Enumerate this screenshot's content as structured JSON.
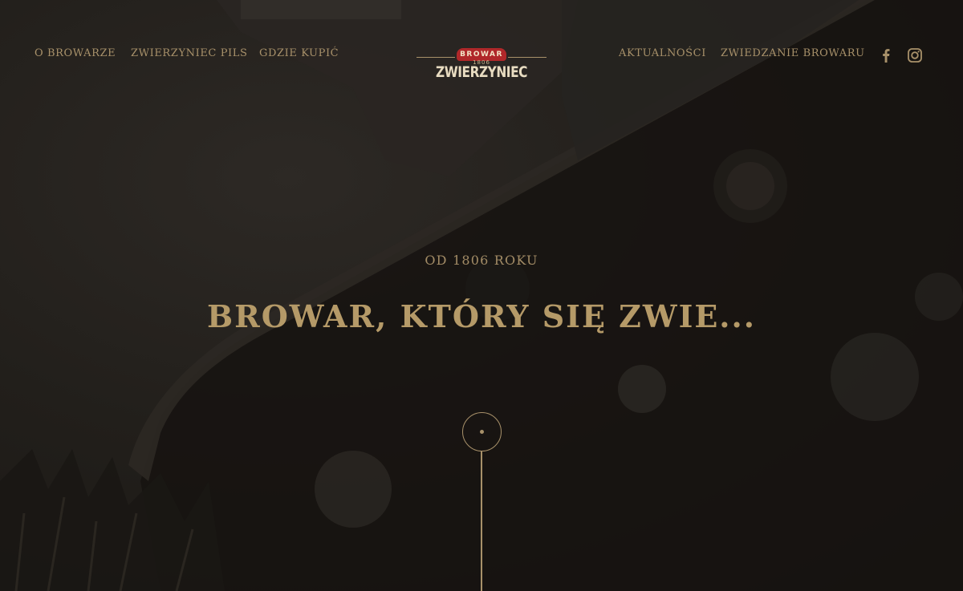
{
  "nav": {
    "left": [
      {
        "label": "O BROWARZE"
      },
      {
        "label": "ZWIERZYNIEC PILS"
      },
      {
        "label": "GDZIE KUPIĆ"
      }
    ],
    "right": [
      {
        "label": "AKTUALNOŚCI"
      },
      {
        "label": "ZWIEDZANIE BROWARU"
      }
    ]
  },
  "logo": {
    "banner": "BROWAR",
    "year": "1806",
    "wordmark": "ZWIERZYNIEC"
  },
  "social": {
    "facebook_icon": "facebook-icon",
    "instagram_icon": "instagram-icon"
  },
  "hero": {
    "eyebrow": "OD 1806 ROKU",
    "headline": "BROWAR, KTÓRY SIĘ ZWIE..."
  },
  "colors": {
    "background": "#1d1a17",
    "gold": "#a8916a",
    "logo_red": "#b0282a"
  }
}
